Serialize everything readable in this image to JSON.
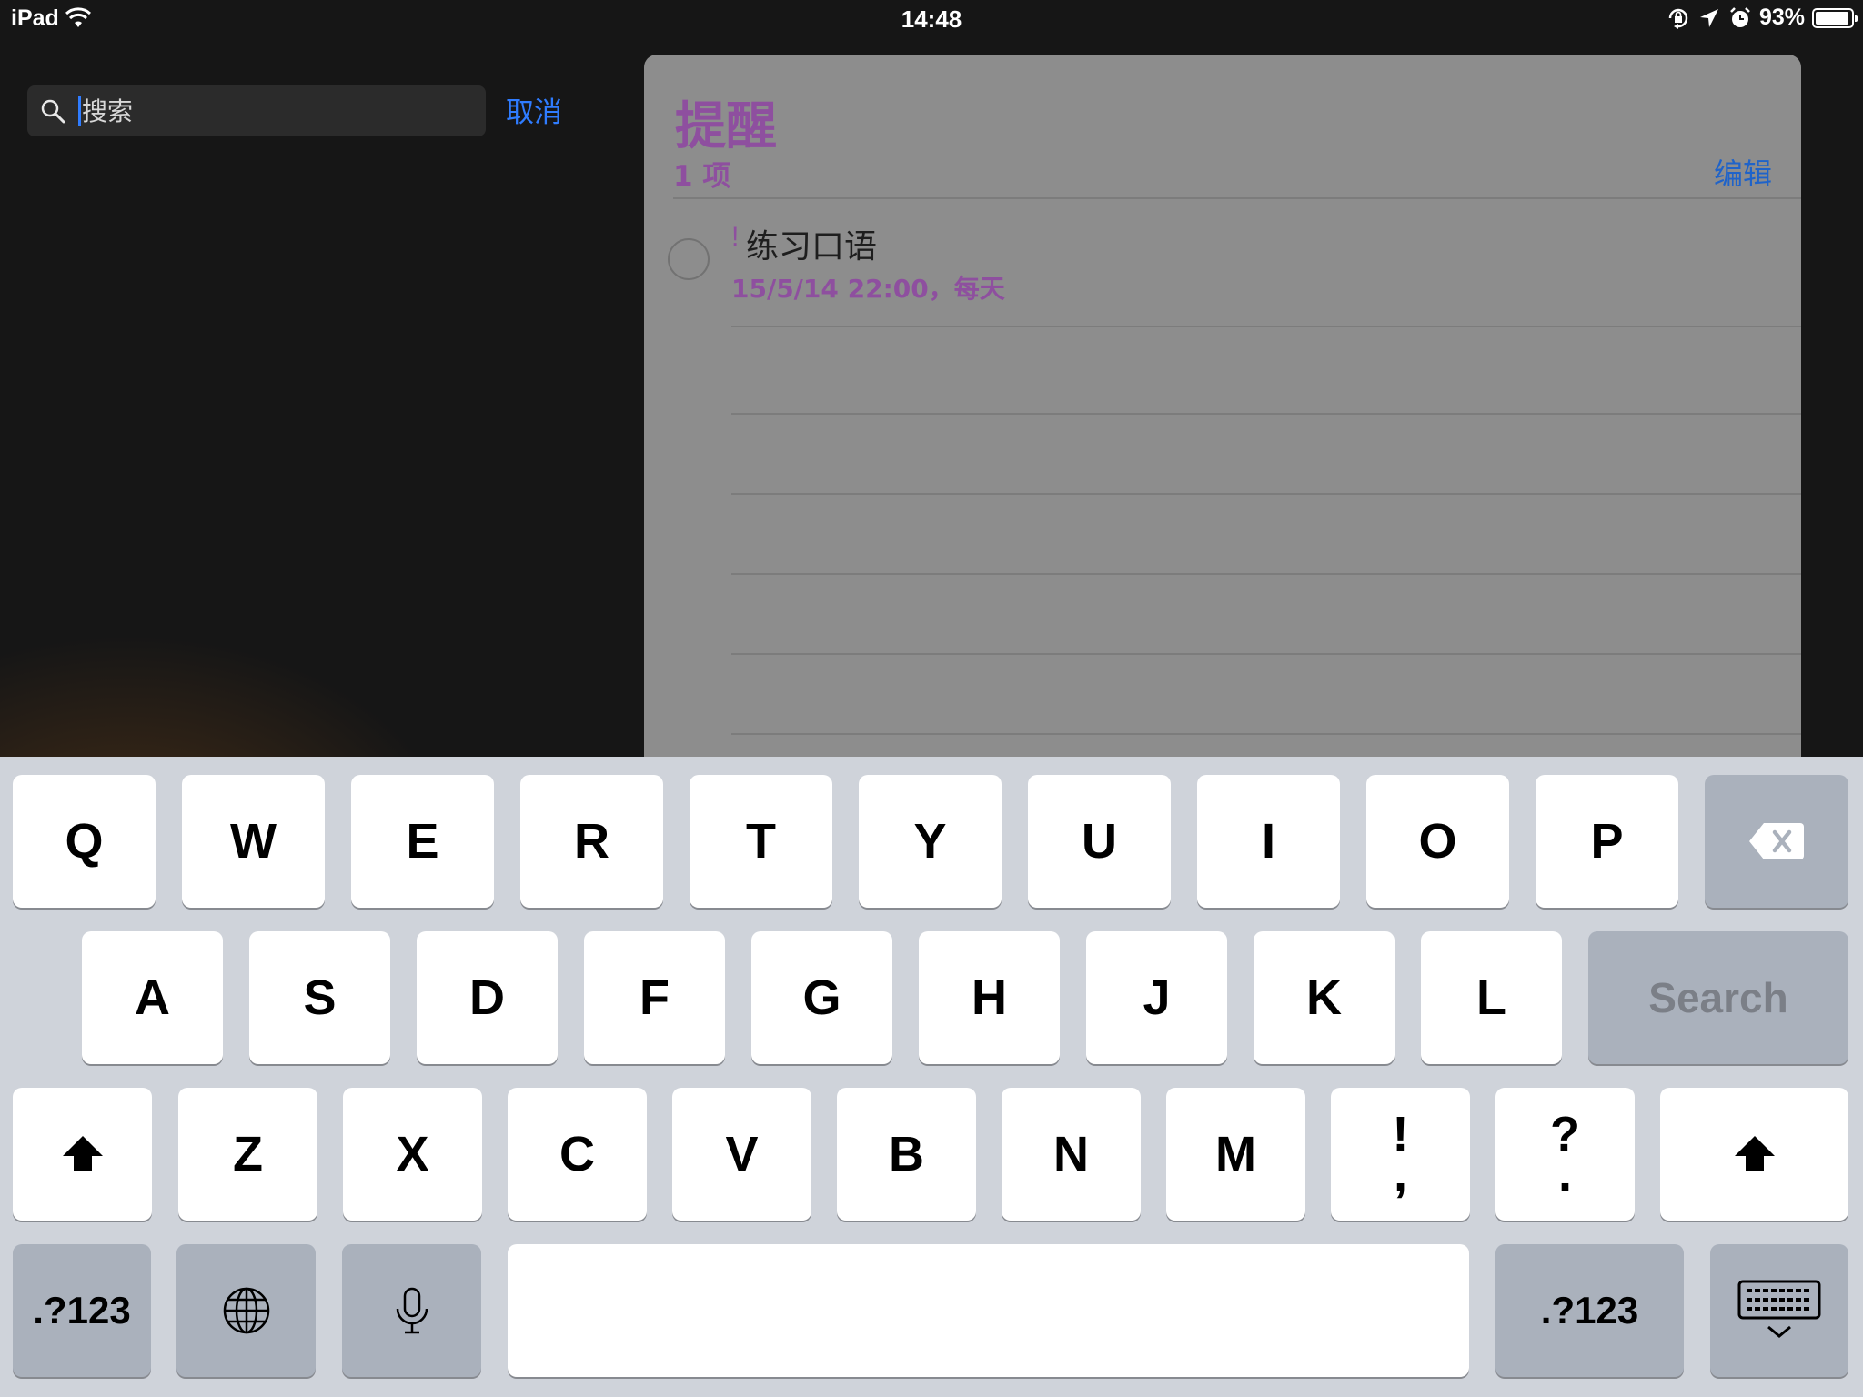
{
  "status_bar": {
    "device": "iPad",
    "time": "14:48",
    "battery_percent": "93%"
  },
  "search": {
    "placeholder": "搜索",
    "value": "",
    "cancel_label": "取消"
  },
  "reminders": {
    "title": "提醒",
    "count": "1 项",
    "edit_label": "编辑",
    "accent_color": "#8e4f9f",
    "items": [
      {
        "priority": "!",
        "title": "练习口语",
        "due": "15/5/14 22:00，每天"
      }
    ]
  },
  "keyboard": {
    "row1": [
      "Q",
      "W",
      "E",
      "R",
      "T",
      "Y",
      "U",
      "I",
      "O",
      "P"
    ],
    "row2": [
      "A",
      "S",
      "D",
      "F",
      "G",
      "H",
      "J",
      "K",
      "L"
    ],
    "row3": [
      "Z",
      "X",
      "C",
      "V",
      "B",
      "N",
      "M"
    ],
    "punct1": {
      "top": "!",
      "bottom": ","
    },
    "punct2": {
      "top": "?",
      "bottom": "."
    },
    "search_label": "Search",
    "numbers_label": ".?123",
    "icons": {
      "delete": "delete-icon",
      "shift": "shift-icon",
      "globe": "globe-icon",
      "mic": "microphone-icon",
      "dismiss": "keyboard-dismiss-icon"
    }
  }
}
